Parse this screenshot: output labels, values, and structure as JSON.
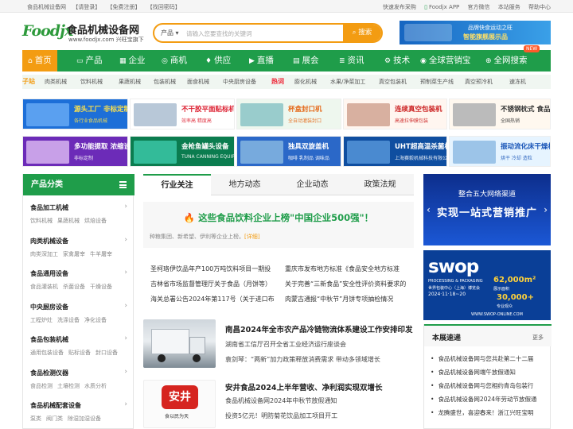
{
  "topbar": {
    "left": [
      "食品机械设备网",
      "【请登录】",
      "【免费注册】",
      "【找回密码】"
    ],
    "right": [
      "快速发布采购",
      "Foodjx APP",
      "官方微信",
      "本站服务",
      "帮助中心"
    ]
  },
  "logo": {
    "mark": "Foodjx",
    "name": "食品机械设备网",
    "url": "www.foodjx.com 兴旺宝旗下"
  },
  "search": {
    "category": "产品",
    "placeholder": "请输入您要查找的关键词",
    "button": "搜索"
  },
  "header_ad": {
    "line1": "品牌快食运动之旺",
    "line2": "智能旗舰展示品"
  },
  "nav": [
    {
      "icon": "⌂",
      "label": "首页",
      "active": true
    },
    {
      "icon": "▭",
      "label": "产品"
    },
    {
      "icon": "▦",
      "label": "企业"
    },
    {
      "icon": "◎",
      "label": "商机"
    },
    {
      "icon": "♦",
      "label": "供应"
    },
    {
      "icon": "▶",
      "label": "直播"
    },
    {
      "icon": "▤",
      "label": "展会"
    },
    {
      "icon": "≣",
      "label": "资讯"
    },
    {
      "icon": "⚙",
      "label": "技术"
    },
    {
      "icon": "◉",
      "label": "全球营销宝"
    },
    {
      "icon": "⊕",
      "label": "全网搜索"
    }
  ],
  "nav_badge": "NEW",
  "hot": {
    "tag1": "子站",
    "items1": [
      "肉类机械",
      "饮料机械",
      "果蔬机械",
      "包装机械",
      "面食机械",
      "中央厨房设备"
    ],
    "tag2": "热词",
    "items2": [
      "膨化机械",
      "水果/净菜加工",
      "真空包装机",
      "预制菜生产线",
      "真空预冷机",
      "速冻机"
    ]
  },
  "banners": [
    {
      "title": "源头工厂 非标定制",
      "sub": "各行业食品机械",
      "bg": "#1d6fd8",
      "color": "#ffe24a",
      "pic": "#5aa0f0"
    },
    {
      "title": "不干胶平面贴标机",
      "sub": "效率高 精度高",
      "bg": "#ffffff",
      "color": "#d23",
      "pic": "#b8c8d8"
    },
    {
      "title": "杯盒封口机",
      "sub": "全自动灌装封口",
      "bg": "#eef7ee",
      "color": "#e56a1a",
      "pic": "#9cc"
    },
    {
      "title": "连续真空包装机",
      "sub": "高速拉伸膜包装",
      "bg": "#fff6f0",
      "color": "#c22",
      "pic": "#d8b0a0"
    },
    {
      "title": "不锈钢枕式 食品包装机",
      "sub": "全国热销",
      "bg": "#fff8ef",
      "color": "#333",
      "pic": "#bbb"
    },
    {
      "title": "多功能提取 浓缩设备",
      "sub": "非标定制",
      "bg": "#6c2bb8",
      "color": "#fff",
      "pic": "#c8a0e8"
    },
    {
      "title": "金枪鱼罐头设备",
      "sub": "TUNA CANNING EQUIPMENT",
      "bg": "#0b7c4f",
      "color": "#fff",
      "pic": "#3b9"
    },
    {
      "title": "独具双旋盖机",
      "sub": "咖啡 乳制品 调味品",
      "bg": "#2b68c8",
      "color": "#fff",
      "pic": "#7ad"
    },
    {
      "title": "UHT超高温杀菌机",
      "sub": "上海赛毅机械科技有限公司",
      "bg": "#0f4ea0",
      "color": "#fff",
      "pic": "#4a8ad0"
    },
    {
      "title": "振动流化床干燥机",
      "sub": "烘干 冷却 造粒",
      "bg": "#e6f4ff",
      "color": "#1a56b8",
      "pic": "#9cc4e8"
    }
  ],
  "sidebar": {
    "title": "产品分类",
    "cats": [
      {
        "title": "食品加工机械",
        "subs": [
          "饮料机械",
          "果蔬机械",
          "烘焙设备"
        ]
      },
      {
        "title": "肉类机械设备",
        "subs": [
          "肉类深加工",
          "家禽屠宰",
          "牛羊屠宰"
        ]
      },
      {
        "title": "食品通用设备",
        "subs": [
          "食品灌装机",
          "杀菌设备",
          "干燥设备"
        ]
      },
      {
        "title": "中央厨房设备",
        "subs": [
          "工程炉灶",
          "洗涤设备",
          "净化设备"
        ]
      },
      {
        "title": "食品包装机械",
        "subs": [
          "通用包装设备",
          "贴标设备",
          "封口设备"
        ]
      },
      {
        "title": "食品检测仪器",
        "subs": [
          "食品检测",
          "土壤检测",
          "水质分析"
        ]
      },
      {
        "title": "食品机械配套设备",
        "subs": [
          "泵类",
          "阀门类",
          "除湿加湿设备"
        ]
      }
    ]
  },
  "tabs": [
    "行业关注",
    "地方动态",
    "企业动态",
    "政策法规"
  ],
  "headline": {
    "icon": "🔥",
    "title": "这些食品饮料企业上榜\"中国企业500强\"！",
    "summary": "种粮集团、新希望、伊利等企业上榜。",
    "more": "[详细]"
  },
  "news_left": [
    "圣柯珞伊饮品年产100万吨饮料项目一期投",
    "吉林省市场监督管理厅关于食品（月饼等）",
    "海关总署公告2024年第117号（关于进口布"
  ],
  "news_right": [
    "重庆市发布地方标准《食品安全地方标准",
    "关于完善“三新食品”安全性评价资料要求的",
    "肉蒙古通报“中秋节”月饼专项抽检情况"
  ],
  "news_items": [
    {
      "title": "南昌2024年全市农产品冷链物流体系建设工作安排印发",
      "subs": [
        "湖南省工信厅召开全省工业经济运行座谈会",
        "袁剑琴：“两新”加力政策释放消费需求 带动多领域增长"
      ]
    },
    {
      "title": "安井食品2024上半年营收、净利润实现双增长",
      "subs": [
        "食品机械设备网2024年中秋节放假通知",
        "投资5亿元！明防菊花饮品加工项目开工"
      ]
    }
  ],
  "ad_right1": {
    "top": "整合五大网络渠道",
    "main": "实现一站式营销推广"
  },
  "ad_right2": {
    "brand": "swop",
    "sub": "PROCESSING & PACKAGING",
    "fair": "世界包装中心（上海）博览会",
    "dates": "2024·11·18~20",
    "area": "62,000m²",
    "area_label": "展示面积",
    "visitors": "30,000+",
    "visitors_label": "专业观众",
    "site": "WWW.SWOP-ONLINE.COM"
  },
  "notice": {
    "title": "本展速递",
    "more": "更多",
    "items": [
      "食品机械设备网与您共赴第二十二届",
      "食品机械设备网端午放假通知",
      "食品机械设备网与您相约青岛包装行",
      "食品机械设备网2024年劳动节放假通",
      "龙腾盛世，喜迎春来！浙江兴旺宝明"
    ]
  },
  "colors": {
    "brand_green": "#1f9d4a",
    "accent_orange": "#f39c12"
  }
}
